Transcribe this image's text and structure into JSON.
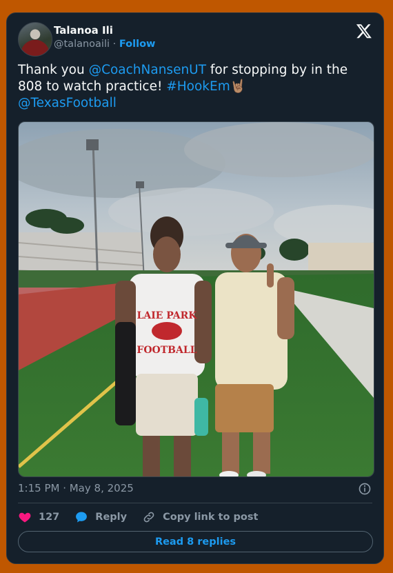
{
  "author": {
    "name": "Talanoa Ili",
    "handle": "@talanoaili",
    "separator": "·",
    "follow_label": "Follow"
  },
  "tweet": {
    "text_1": "Thank you ",
    "mention_1": "@CoachNansenUT",
    "text_2": " for stopping by in the 808 to watch practice! ",
    "hashtag": "#HookEm",
    "emoji": "🤘🏽",
    "mention_2": "@TexasFootball"
  },
  "photo": {
    "shirt_line1": "LAIE PARK",
    "shirt_line2": "FOOTBALL"
  },
  "meta": {
    "timestamp": "1:15 PM · May 8, 2025"
  },
  "actions": {
    "like_count": "127",
    "reply_label": "Reply",
    "copy_label": "Copy link to post",
    "read_replies_label": "Read 8 replies"
  },
  "colors": {
    "page_bg": "#bf5700",
    "card_bg": "#15202b",
    "accent": "#1d9bf0",
    "like": "#f91880"
  }
}
